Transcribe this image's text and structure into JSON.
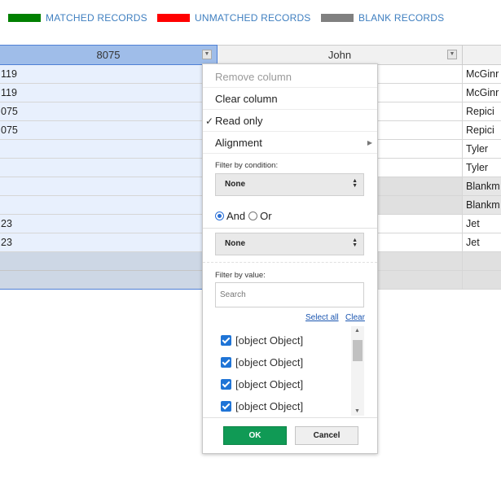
{
  "legend": {
    "matched": {
      "label": "MATCHED RECORDS",
      "color": "#008000"
    },
    "unmatched": {
      "label": "UNMATCHED RECORDS",
      "color": "#ff0000"
    },
    "blank": {
      "label": "BLANK RECORDS",
      "color": "#808080"
    }
  },
  "grid": {
    "headers": [
      "8075",
      "John",
      ""
    ],
    "rows": [
      {
        "c1": "119",
        "c3": "McGinr"
      },
      {
        "c1": "119",
        "c3": "McGinr"
      },
      {
        "c1": "075",
        "c3": "Repici"
      },
      {
        "c1": "075",
        "c3": "Repici"
      },
      {
        "c1": "",
        "c3": "Tyler"
      },
      {
        "c1": "",
        "c3": "Tyler"
      },
      {
        "c1": "",
        "c3": "Blankm"
      },
      {
        "c1": "",
        "c3": "Blankm"
      },
      {
        "c1": "23",
        "c3": "Jet"
      },
      {
        "c1": "23",
        "c3": "Jet"
      },
      {
        "c1": "",
        "c3": ""
      },
      {
        "c1": "",
        "c3": ""
      }
    ]
  },
  "menu": {
    "items": {
      "remove_column": "Remove column",
      "clear_column": "Clear column",
      "read_only": "Read only",
      "read_only_check": "✓",
      "alignment": "Alignment"
    },
    "filter_by_condition": {
      "label": "Filter by condition:",
      "select1": "None",
      "and_label": "And",
      "or_label": "Or",
      "selected_operator": "And",
      "select2": "None"
    },
    "filter_by_value": {
      "label": "Filter by value:",
      "search_placeholder": "Search",
      "select_all": "Select all",
      "clear": "Clear",
      "values": [
        "[object Object]",
        "[object Object]",
        "[object Object]",
        "[object Object]"
      ]
    },
    "buttons": {
      "ok": "OK",
      "cancel": "Cancel"
    }
  }
}
